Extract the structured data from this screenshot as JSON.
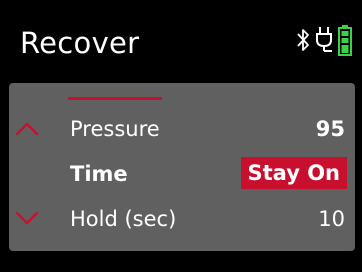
{
  "header": {
    "title": "Recover",
    "icons": [
      "bluetooth-icon",
      "plug-icon",
      "battery-icon"
    ],
    "battery_color": "#39d24a"
  },
  "menu": {
    "items": [
      {
        "label": "Pressure",
        "value": "95",
        "arrow": "up"
      },
      {
        "label": "Time",
        "value": "Stay On",
        "selected": true
      },
      {
        "label": "Hold (sec)",
        "value": "10",
        "arrow": "down"
      }
    ]
  },
  "colors": {
    "accent": "#c8102e",
    "panel": "#606060",
    "background": "#000000",
    "text": "#ffffff"
  }
}
